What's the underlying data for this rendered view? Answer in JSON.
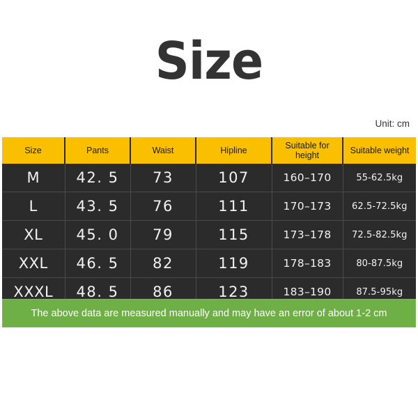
{
  "page": {
    "title": "Size",
    "unit_label": "Unit: cm"
  },
  "colors": {
    "header_yellow": "#fac000",
    "cell_dark": "#2b2b2b",
    "note_green": "#6eaf46",
    "title_gray": "#333333",
    "text_light": "#f2f2f2"
  },
  "table": {
    "headers": [
      "Size",
      "Pants",
      "Waist",
      "Hipline",
      "Suitable for height",
      "Suitable weight"
    ],
    "rows": [
      {
        "size": "M",
        "pants": "42. 5",
        "waist": "73",
        "hipline": "107",
        "height": "160–170",
        "weight": "55-62.5kg"
      },
      {
        "size": "L",
        "pants": "43. 5",
        "waist": "76",
        "hipline": "111",
        "height": "170–173",
        "weight": "62.5-72.5kg"
      },
      {
        "size": "XL",
        "pants": "45. 0",
        "waist": "79",
        "hipline": "115",
        "height": "173–178",
        "weight": "72.5-82.5kg"
      },
      {
        "size": "XXL",
        "pants": "46. 5",
        "waist": "82",
        "hipline": "119",
        "height": "178–183",
        "weight": "80-87.5kg"
      },
      {
        "size": "XXXL",
        "pants": "48. 5",
        "waist": "86",
        "hipline": "123",
        "height": "183–190",
        "weight": "87.5-95kg"
      }
    ]
  },
  "note": {
    "text": "The above data are measured manually and may have an error of about 1-2 cm"
  }
}
